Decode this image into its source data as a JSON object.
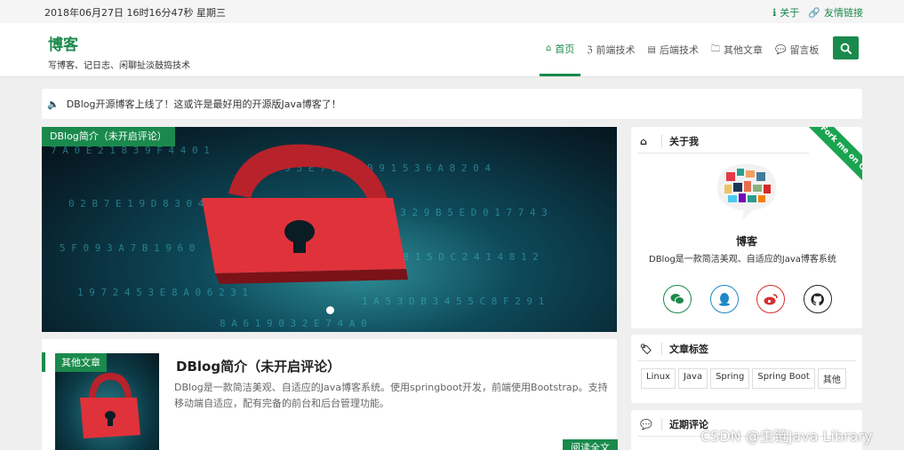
{
  "topbar": {
    "datetime": "2018年06月27日 16时16分47秒 星期三",
    "about_label": "关于",
    "friends_label": "友情链接"
  },
  "brand": {
    "name": "博客",
    "slogan": "写博客、记日志、闲聊扯淡鼓捣技术"
  },
  "nav": {
    "items": [
      {
        "label": "首页",
        "icon": "home-icon",
        "active": true
      },
      {
        "label": "前端技术",
        "icon": "html5-icon"
      },
      {
        "label": "后端技术",
        "icon": "server-icon"
      },
      {
        "label": "其他文章",
        "icon": "folder-icon"
      },
      {
        "label": "留言板",
        "icon": "comments-icon"
      }
    ],
    "search_icon": "search-icon"
  },
  "notice": {
    "text": "DBlog开源博客上线了！这或许是最好用的开源版Java博客了！"
  },
  "carousel": {
    "caption": "DBlog简介（未开启评论）"
  },
  "article": {
    "category": "其他文章",
    "title": "DBlog简介（未开启评论）",
    "summary": "DBlog是一款简洁美观、自适应的Java博客系统。使用springboot开发，前端使用Bootstrap。支持移动端自适应，配有完备的前台和后台管理功能。",
    "read_more": "阅读全文"
  },
  "sidebar": {
    "about": {
      "title": "关于我",
      "ribbon": "Fork me on Gitee",
      "name": "博客",
      "description": "DBlog是一款简洁美观、自适应的Java博客系统",
      "socials": [
        {
          "icon": "wechat-icon",
          "color": "#1a8a4c"
        },
        {
          "icon": "qq-icon",
          "color": "#1e88c8"
        },
        {
          "icon": "weibo-icon",
          "color": "#d62d2d"
        },
        {
          "icon": "github-icon",
          "color": "#222222"
        }
      ]
    },
    "tags": {
      "title": "文章标签",
      "items": [
        "Linux",
        "Java",
        "Spring",
        "Spring Boot",
        "其他"
      ]
    },
    "recent_comments": {
      "title": "近期评论"
    }
  },
  "watermark": "CSDN @虫链Java Library",
  "colors": {
    "accent": "#1a8a4c",
    "background": "#efefef"
  }
}
